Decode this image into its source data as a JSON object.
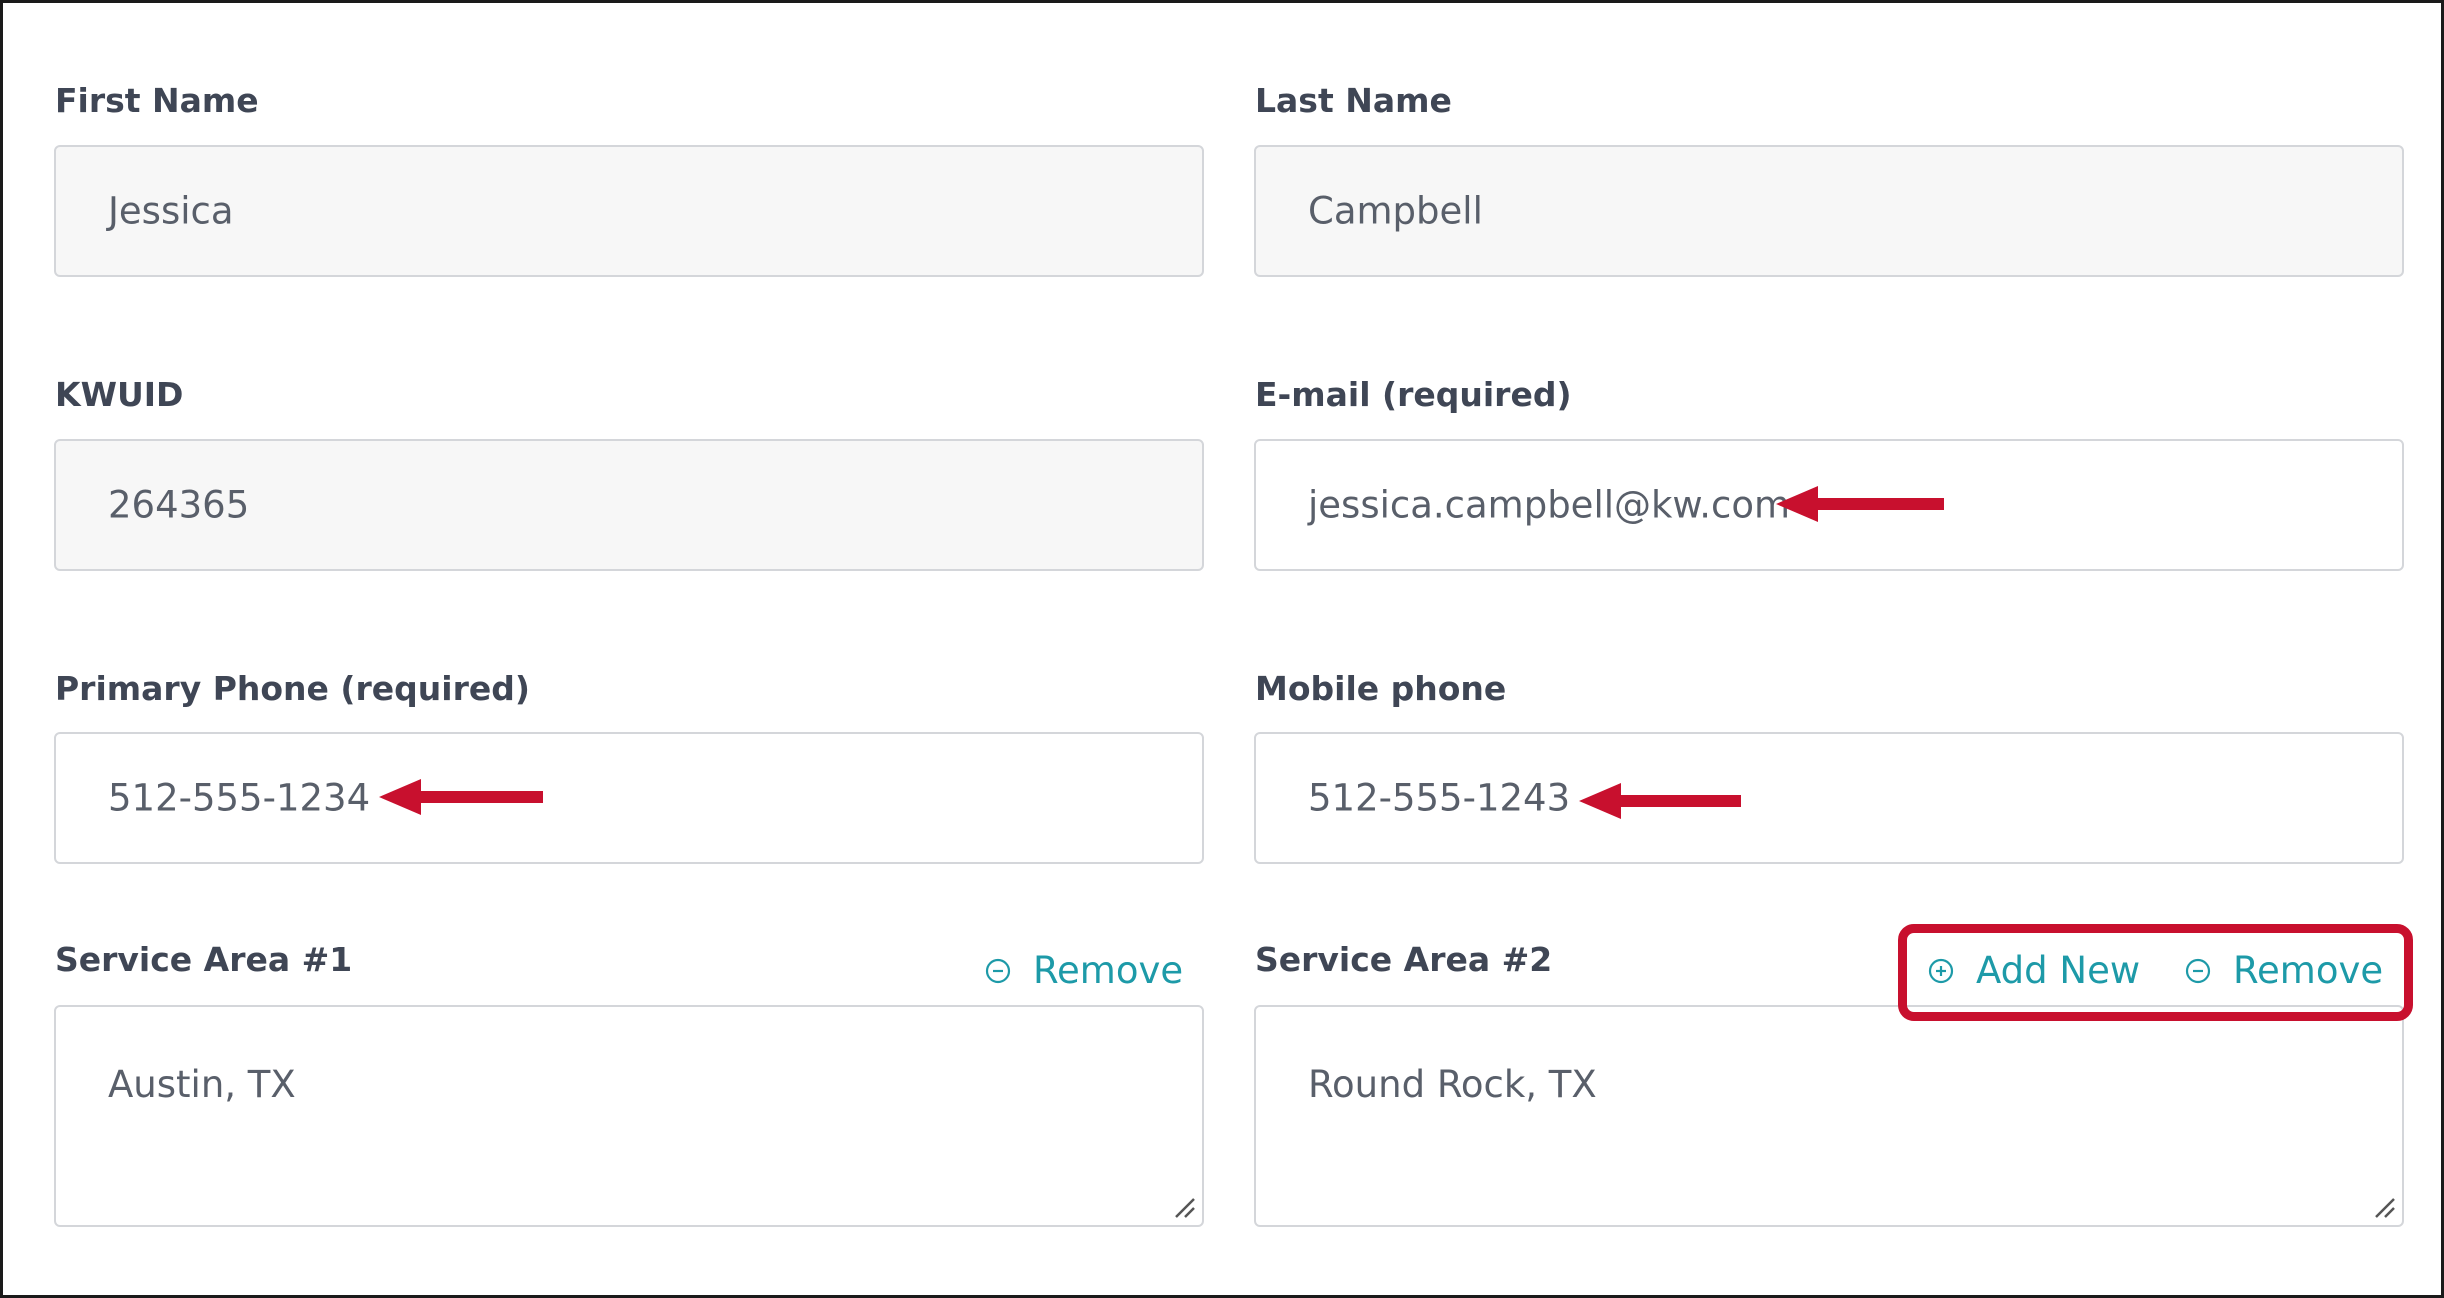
{
  "form": {
    "first_name": {
      "label": "First Name",
      "value": "Jessica"
    },
    "last_name": {
      "label": "Last Name",
      "value": "Campbell"
    },
    "kwuid": {
      "label": "KWUID",
      "value": "264365"
    },
    "email": {
      "label": "E-mail (required)",
      "value": "jessica.campbell@kw.com"
    },
    "primary_phone": {
      "label": "Primary Phone (required)",
      "value": "512-555-1234"
    },
    "mobile_phone": {
      "label": "Mobile phone",
      "value": "512-555-1243"
    },
    "service_area_1": {
      "label": "Service Area #1",
      "value": "Austin, TX",
      "remove_label": "Remove"
    },
    "service_area_2": {
      "label": "Service Area #2",
      "value": "Round Rock, TX",
      "add_label": "Add New",
      "remove_label": "Remove"
    }
  },
  "annotations": {
    "arrow_color": "#c8102e",
    "highlight_color": "#c8102e"
  },
  "colors": {
    "accent": "#1d9aa8",
    "label": "#3f4655",
    "value": "#595f6a",
    "disabled_bg": "#f7f7f7"
  }
}
